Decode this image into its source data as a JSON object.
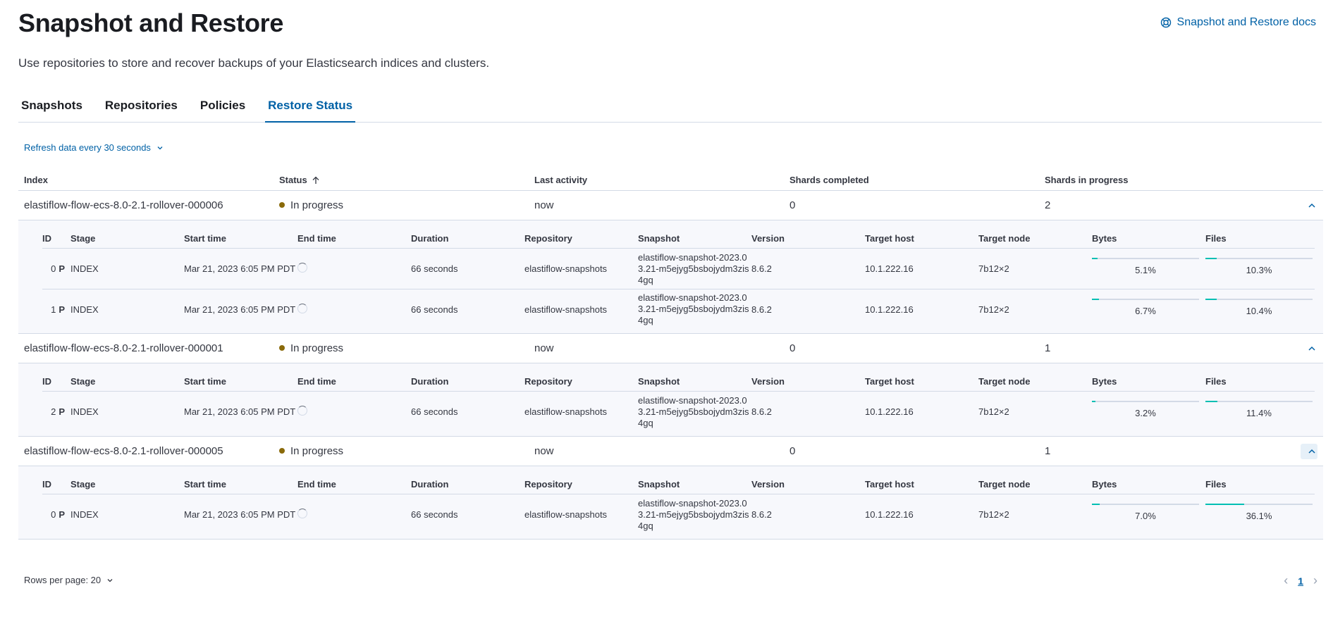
{
  "header": {
    "title": "Snapshot and Restore",
    "docs_link": "Snapshot and Restore docs",
    "description": "Use repositories to store and recover backups of your Elasticsearch indices and clusters."
  },
  "tabs": [
    {
      "label": "Snapshots",
      "active": false
    },
    {
      "label": "Repositories",
      "active": false
    },
    {
      "label": "Policies",
      "active": false
    },
    {
      "label": "Restore Status",
      "active": true
    }
  ],
  "refresh_label": "Refresh data every 30 seconds",
  "columns": [
    "Index",
    "Status",
    "Last activity",
    "Shards completed",
    "Shards in progress"
  ],
  "shard_columns": [
    "ID",
    "Stage",
    "Start time",
    "End time",
    "Duration",
    "Repository",
    "Snapshot",
    "Version",
    "Target host",
    "Target node",
    "Bytes",
    "Files"
  ],
  "indices": [
    {
      "name": "elastiflow-flow-ecs-8.0-2.1-rollover-000006",
      "status": "In progress",
      "last_activity": "now",
      "shards_completed": "0",
      "shards_in_progress": "2",
      "shards": [
        {
          "id": "0",
          "primary": "P",
          "stage": "INDEX",
          "start": "Mar 21, 2023 6:05 PM PDT",
          "duration": "66 seconds",
          "repository": "elastiflow-snapshots",
          "snapshot": "elastiflow-snapshot-2023.03.21-m5ejyg5bsbojydm3zis4gq",
          "version": "8.6.2",
          "host": "10.1.222.16",
          "node": "7b12×2",
          "bytes": "5.1%",
          "bytes_frac": 0.051,
          "files": "10.3%",
          "files_frac": 0.103
        },
        {
          "id": "1",
          "primary": "P",
          "stage": "INDEX",
          "start": "Mar 21, 2023 6:05 PM PDT",
          "duration": "66 seconds",
          "repository": "elastiflow-snapshots",
          "snapshot": "elastiflow-snapshot-2023.03.21-m5ejyg5bsbojydm3zis4gq",
          "version": "8.6.2",
          "host": "10.1.222.16",
          "node": "7b12×2",
          "bytes": "6.7%",
          "bytes_frac": 0.067,
          "files": "10.4%",
          "files_frac": 0.104
        }
      ]
    },
    {
      "name": "elastiflow-flow-ecs-8.0-2.1-rollover-000001",
      "status": "In progress",
      "last_activity": "now",
      "shards_completed": "0",
      "shards_in_progress": "1",
      "shards": [
        {
          "id": "2",
          "primary": "P",
          "stage": "INDEX",
          "start": "Mar 21, 2023 6:05 PM PDT",
          "duration": "66 seconds",
          "repository": "elastiflow-snapshots",
          "snapshot": "elastiflow-snapshot-2023.03.21-m5ejyg5bsbojydm3zis4gq",
          "version": "8.6.2",
          "host": "10.1.222.16",
          "node": "7b12×2",
          "bytes": "3.2%",
          "bytes_frac": 0.032,
          "files": "11.4%",
          "files_frac": 0.114
        }
      ]
    },
    {
      "name": "elastiflow-flow-ecs-8.0-2.1-rollover-000005",
      "status": "In progress",
      "last_activity": "now",
      "shards_completed": "0",
      "shards_in_progress": "1",
      "shards": [
        {
          "id": "0",
          "primary": "P",
          "stage": "INDEX",
          "start": "Mar 21, 2023 6:05 PM PDT",
          "duration": "66 seconds",
          "repository": "elastiflow-snapshots",
          "snapshot": "elastiflow-snapshot-2023.03.21-m5ejyg5bsbojydm3zis4gq",
          "version": "8.6.2",
          "host": "10.1.222.16",
          "node": "7b12×2",
          "bytes": "7.0%",
          "bytes_frac": 0.07,
          "files": "36.1%",
          "files_frac": 0.361
        }
      ]
    }
  ],
  "footer": {
    "rows_per_page": "Rows per page: 20",
    "page": "1"
  },
  "colors": {
    "accent": "#0061a6",
    "progress": "#00bfb3",
    "status_dot": "#8a6a0a"
  }
}
